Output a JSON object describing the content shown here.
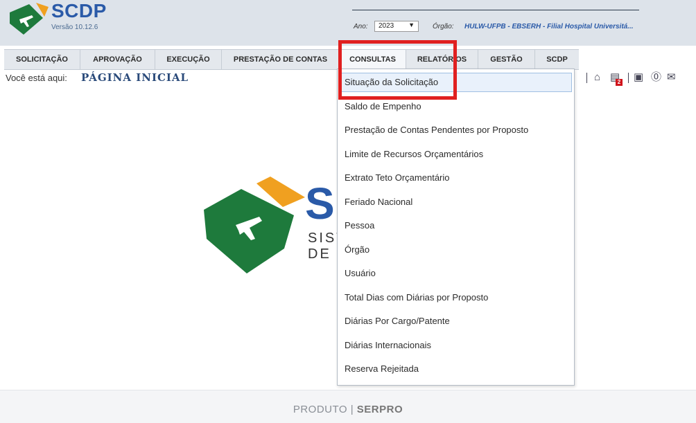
{
  "header": {
    "app_name": "SCDP",
    "version": "Versão 10.12.6",
    "ano_label": "Ano:",
    "ano_value": "2023",
    "orgao_label": "Órgão:",
    "orgao_value": "HULW-UFPB - EBSERH - Filial Hospital Universitá..."
  },
  "nav": {
    "items": [
      {
        "label": "SOLICITAÇÃO"
      },
      {
        "label": "APROVAÇÃO"
      },
      {
        "label": "EXECUÇÃO"
      },
      {
        "label": "PRESTAÇÃO DE CONTAS"
      },
      {
        "label": "CONSULTAS"
      },
      {
        "label": "RELATÓRIOS"
      },
      {
        "label": "GESTÃO"
      },
      {
        "label": "SCDP"
      }
    ]
  },
  "breadcrumb": {
    "label": "Você está aqui:",
    "value": "PÁGINA INICIAL"
  },
  "toolbar": {
    "badge_count": "2",
    "icons": [
      "home-icon",
      "messages-icon",
      "video-icon",
      "help-icon",
      "mail-icon"
    ]
  },
  "center_logo": {
    "letter": "S",
    "line1": "SIST",
    "line2": "DE D"
  },
  "dropdown": {
    "items": [
      "Situação da Solicitação",
      "Saldo de Empenho",
      "Prestação de Contas Pendentes por Proposto",
      "Limite de Recursos Orçamentários",
      "Extrato Teto Orçamentário",
      "Feriado Nacional",
      "Pessoa",
      "Órgão",
      "Usuário",
      "Total Dias com Diárias por Proposto",
      "Diárias Por Cargo/Patente",
      "Diárias Internacionais",
      "Reserva Rejeitada"
    ]
  },
  "footer": {
    "produto": "PRODUTO",
    "serpro": "SERPRO"
  },
  "colors": {
    "brand_blue": "#2a5aa8",
    "logo_green": "#1e7a3c",
    "logo_orange": "#f0a020",
    "highlight_red": "#e02020"
  }
}
